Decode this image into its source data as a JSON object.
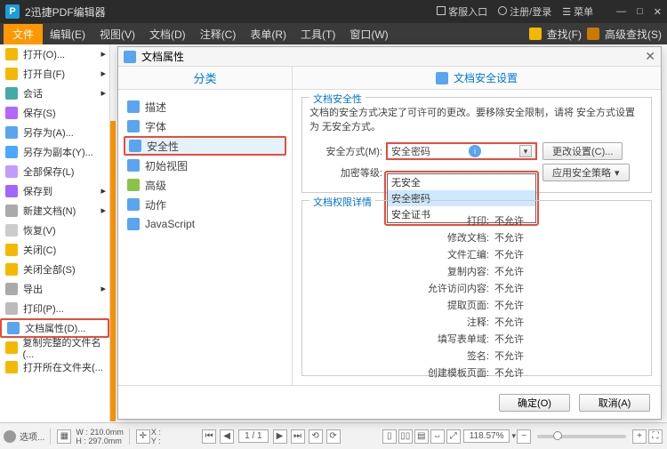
{
  "titlebar": {
    "title": "2迅捷PDF编辑器",
    "customer": "客服入口",
    "login": "注册/登录",
    "menu": "菜单"
  },
  "menubar": {
    "file": "文件",
    "items": [
      "编辑(E)",
      "视图(V)",
      "文档(D)",
      "注释(C)",
      "表单(R)",
      "工具(T)",
      "窗口(W)"
    ],
    "find": "查找(F)",
    "advfind": "高级查找(S)"
  },
  "sidebar": {
    "items": [
      "打开(O)...",
      "打开自(F)",
      "会话",
      "保存(S)",
      "另存为(A)...",
      "另存为副本(Y)...",
      "全部保存(L)",
      "保存到",
      "新建文档(N)",
      "恢复(V)",
      "关闭(C)",
      "关闭全部(S)",
      "导出",
      "打印(P)...",
      "文档属性(D)...",
      "复制完整的文件名(...",
      "打开所在文件夹(..."
    ]
  },
  "dialog": {
    "title": "文档属性",
    "tab_left": "分类",
    "tab_right": "文档安全设置",
    "categories": [
      "描述",
      "字体",
      "安全性",
      "初始视图",
      "高级",
      "动作",
      "JavaScript"
    ],
    "sec_section": "文档安全性",
    "sec_desc": "文档的安全方式决定了可许可的更改。要移除安全限制，请将 安全方式设置为 无安全方式。",
    "sec_method_lbl": "安全方式(M):",
    "sec_method_val": "安全密码",
    "enc_lbl": "加密等级:",
    "change_btn": "更改设置(C)...",
    "apply_btn": "应用安全策略",
    "dropdown": [
      "无安全",
      "安全密码",
      "安全证书"
    ],
    "perm_section": "文档权限详情",
    "perms": [
      {
        "k": "打印:",
        "v": "不允许"
      },
      {
        "k": "修改文档:",
        "v": "不允许"
      },
      {
        "k": "文件汇编:",
        "v": "不允许"
      },
      {
        "k": "复制内容:",
        "v": "不允许"
      },
      {
        "k": "允许访问内容:",
        "v": "不允许"
      },
      {
        "k": "提取页面:",
        "v": "不允许"
      },
      {
        "k": "注释:",
        "v": "不允许"
      },
      {
        "k": "填写表单域:",
        "v": "不允许"
      },
      {
        "k": "签名:",
        "v": "不允许"
      },
      {
        "k": "创建模板页面:",
        "v": "不允许"
      }
    ],
    "ok": "确定(O)",
    "cancel": "取消(A)"
  },
  "status": {
    "options": "选项...",
    "w": "W : 210.0mm",
    "h": "H : 297.0mm",
    "xy": "X :\nY :",
    "page": "1 / 1",
    "zoom": "118.57%"
  }
}
